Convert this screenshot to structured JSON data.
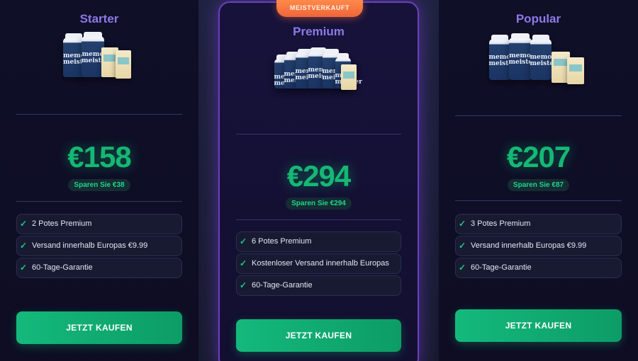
{
  "plans": [
    {
      "name": "Starter",
      "price": "€158",
      "savings": "Sparen Sie €38",
      "features": [
        "2 Potes Premium",
        "Versand innerhalb Europas €9.99",
        "60-Tage-Garantie"
      ],
      "button": "JETZT KAUFEN",
      "product_logo": "memo meister"
    },
    {
      "badge": "MEISTVERKAUFT",
      "name": "Premium",
      "price": "€294",
      "savings": "Sparen Sie €294",
      "features": [
        "6 Potes Premium",
        "Kostenloser Versand innerhalb Europas",
        "60-Tage-Garantie"
      ],
      "button": "JETZT KAUFEN",
      "product_logo": "memo meister"
    },
    {
      "name": "Popular",
      "price": "€207",
      "savings": "Sparen Sie €87",
      "features": [
        "3 Potes Premium",
        "Versand innerhalb Europas €9.99",
        "60-Tage-Garantie"
      ],
      "button": "JETZT KAUFEN",
      "product_logo": "memo meister"
    }
  ],
  "icons": {
    "feature_check": "check-icon"
  },
  "colors": {
    "accent_green": "#14b873",
    "tier_purple": "#8c7ae6",
    "badge_orange": "#f0653a",
    "highlight_border": "#6d3ec0"
  }
}
